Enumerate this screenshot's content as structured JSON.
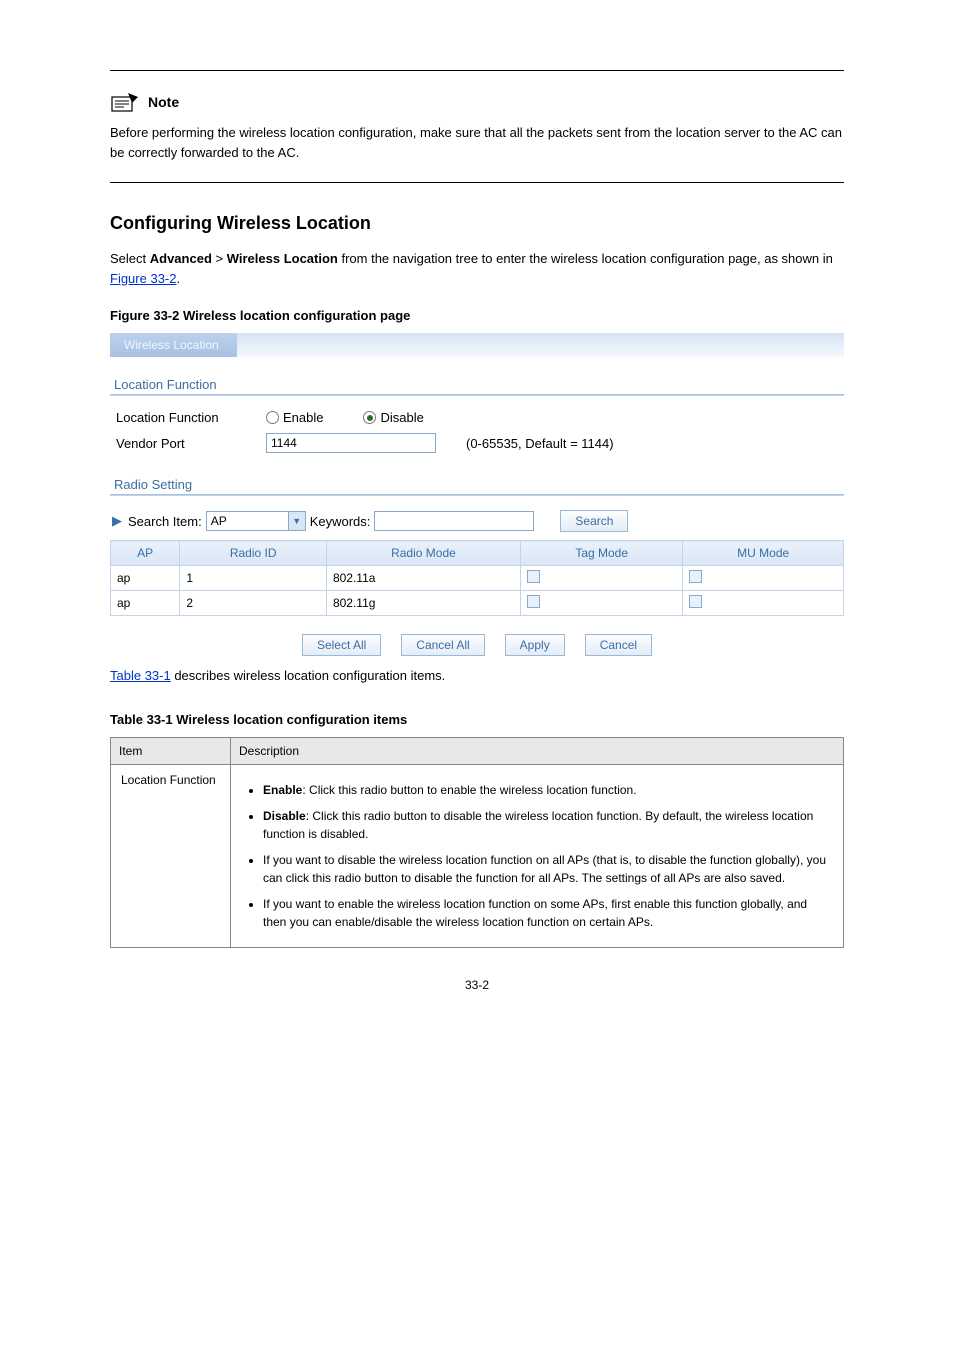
{
  "noteLabel": "Note",
  "noteBody": "Before performing the wireless location configuration, make sure that all the packets sent from the location server to the AC can be correctly forwarded to the AC.",
  "sectionHeading": "Configuring Wireless Location",
  "configText1": "Select ",
  "configBold1": "Advanced",
  "configText2": " > ",
  "configBold2": "Wireless Location",
  "configText3": " from the navigation tree to enter the wireless location configuration page, as shown in ",
  "figLink": "Figure 33-2",
  "configText4": ".",
  "figCaption": "Figure 33-2 Wireless location configuration page",
  "widgetTab": "Wireless Location",
  "locationFunctionHeader": "Location Function",
  "locationFunctionLabel": "Location Function",
  "enableLabel": "Enable",
  "disableLabel": "Disable",
  "vendorPortLabel": "Vendor Port",
  "vendorPortValue": "1144",
  "vendorPortHint": "(0-65535, Default = 1144)",
  "radioSettingHeader": "Radio Setting",
  "searchItemLabel": "Search Item:",
  "searchItemValue": "AP",
  "keywordsLabel": "Keywords:",
  "keywordsValue": "",
  "searchBtn": "Search",
  "col_ap": "AP",
  "col_radioId": "Radio ID",
  "col_radioMode": "Radio Mode",
  "col_tagMode": "Tag Mode",
  "col_muMode": "MU Mode",
  "row1_ap": "ap",
  "row1_radioId": "1",
  "row1_radioMode": "802.11a",
  "row2_ap": "ap",
  "row2_radioId": "2",
  "row2_radioMode": "802.11g",
  "selectAllBtn": "Select All",
  "cancelAllBtn": "Cancel All",
  "applyBtn": "Apply",
  "cancelBtn": "Cancel",
  "descLinkText": "Table 33-1",
  "descLinkTail": " describes wireless location configuration items.",
  "descCaption": "Table 33-1 Wireless location configuration items",
  "th_item": "Item",
  "th_desc": "Description",
  "row_locfun_item": "Location Function",
  "bullet1a": "Enable",
  "bullet1b": ": Click this radio button to enable the wireless location function.",
  "bullet2a": "Disable",
  "bullet2b": ": Click this radio button to disable the wireless location function. By default, the wireless location function is disabled.",
  "bullet3": "If you want to disable the wireless location function on all APs (that is, to disable the function globally), you can click this radio button to disable the function for all APs. The settings of all APs are also saved.",
  "bullet4": "If you want to enable the wireless location function on some APs, first enable this function globally, and then you can enable/disable the wireless location function on certain APs.",
  "pageNum": "33-2"
}
